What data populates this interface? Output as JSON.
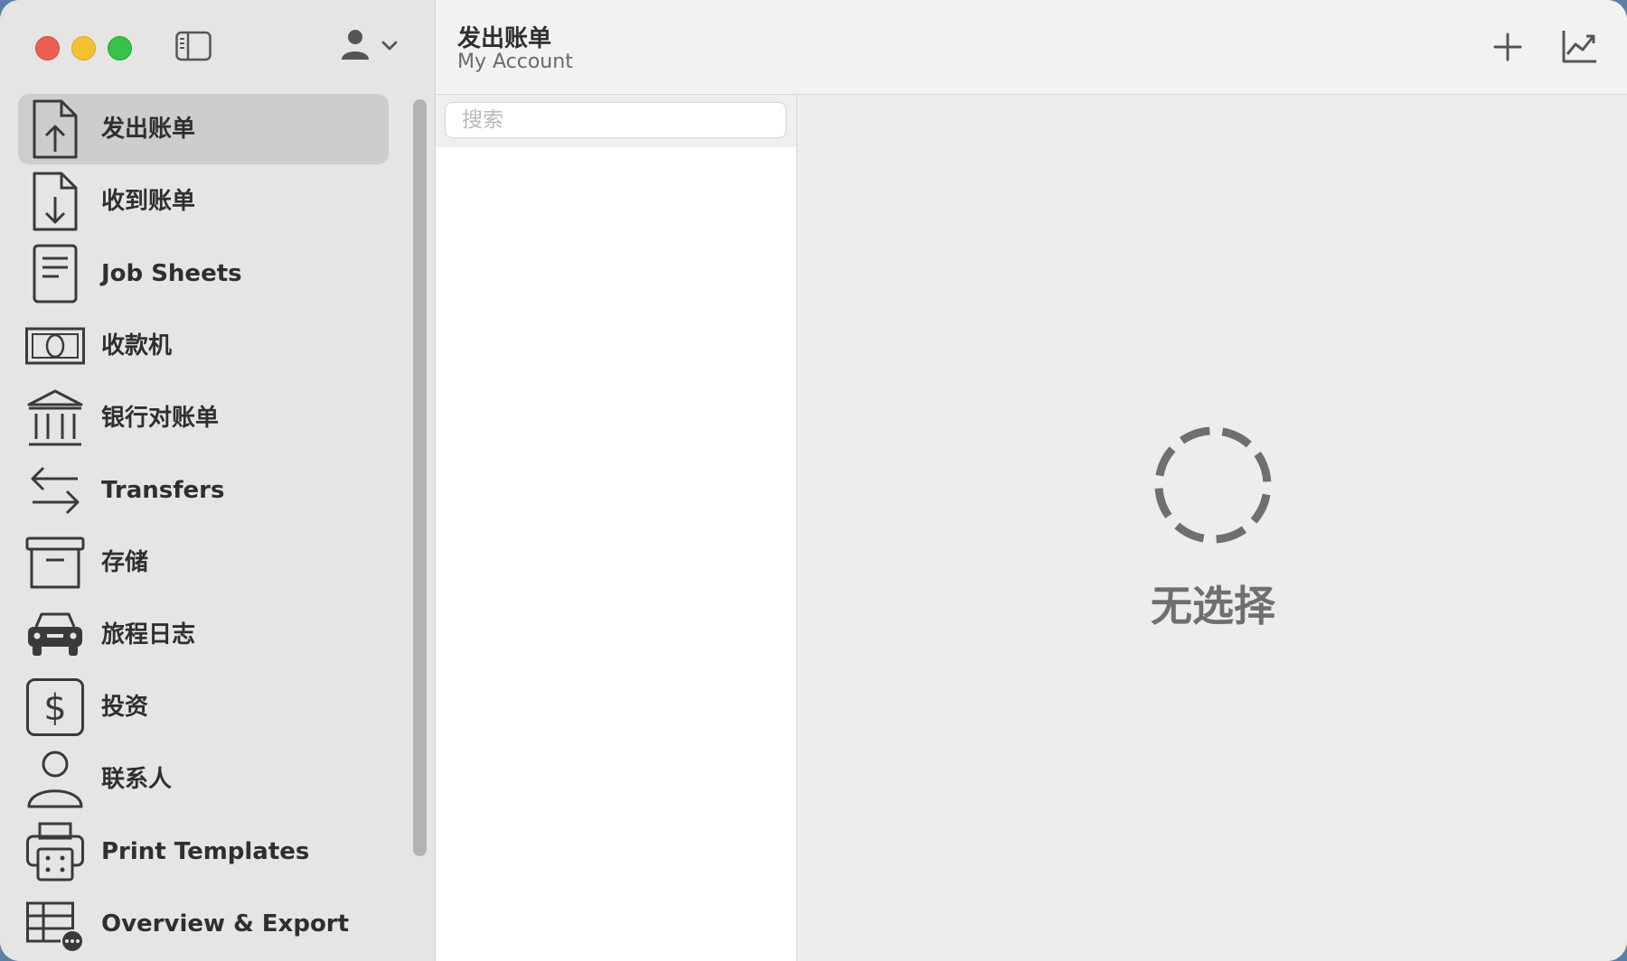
{
  "window": {
    "title": "发出账单",
    "subtitle": "My Account"
  },
  "sidebar": {
    "items": [
      {
        "label": "发出账单",
        "icon": "invoice-out-icon",
        "selected": true
      },
      {
        "label": "收到账单",
        "icon": "invoice-in-icon",
        "selected": false
      },
      {
        "label": "Job Sheets",
        "icon": "job-sheet-icon",
        "selected": false
      },
      {
        "label": "收款机",
        "icon": "cash-register-icon",
        "selected": false
      },
      {
        "label": "银行对账单",
        "icon": "bank-icon",
        "selected": false
      },
      {
        "label": "Transfers",
        "icon": "transfer-arrows-icon",
        "selected": false
      },
      {
        "label": "存储",
        "icon": "archive-box-icon",
        "selected": false
      },
      {
        "label": "旅程日志",
        "icon": "car-icon",
        "selected": false
      },
      {
        "label": "投资",
        "icon": "dollar-icon",
        "selected": false
      },
      {
        "label": "联系人",
        "icon": "person-icon",
        "selected": false
      },
      {
        "label": "Print Templates",
        "icon": "printer-icon",
        "selected": false
      },
      {
        "label": "Overview & Export",
        "icon": "table-export-icon",
        "selected": false
      }
    ]
  },
  "search": {
    "placeholder": "搜索",
    "value": ""
  },
  "detail": {
    "empty_text": "无选择"
  },
  "colors": {
    "selected_bg": "#cdcdcb",
    "sidebar_bg": "#e5e5e3",
    "close": "#ec5f57",
    "minimize": "#f4bf31",
    "zoom": "#37c24a"
  }
}
